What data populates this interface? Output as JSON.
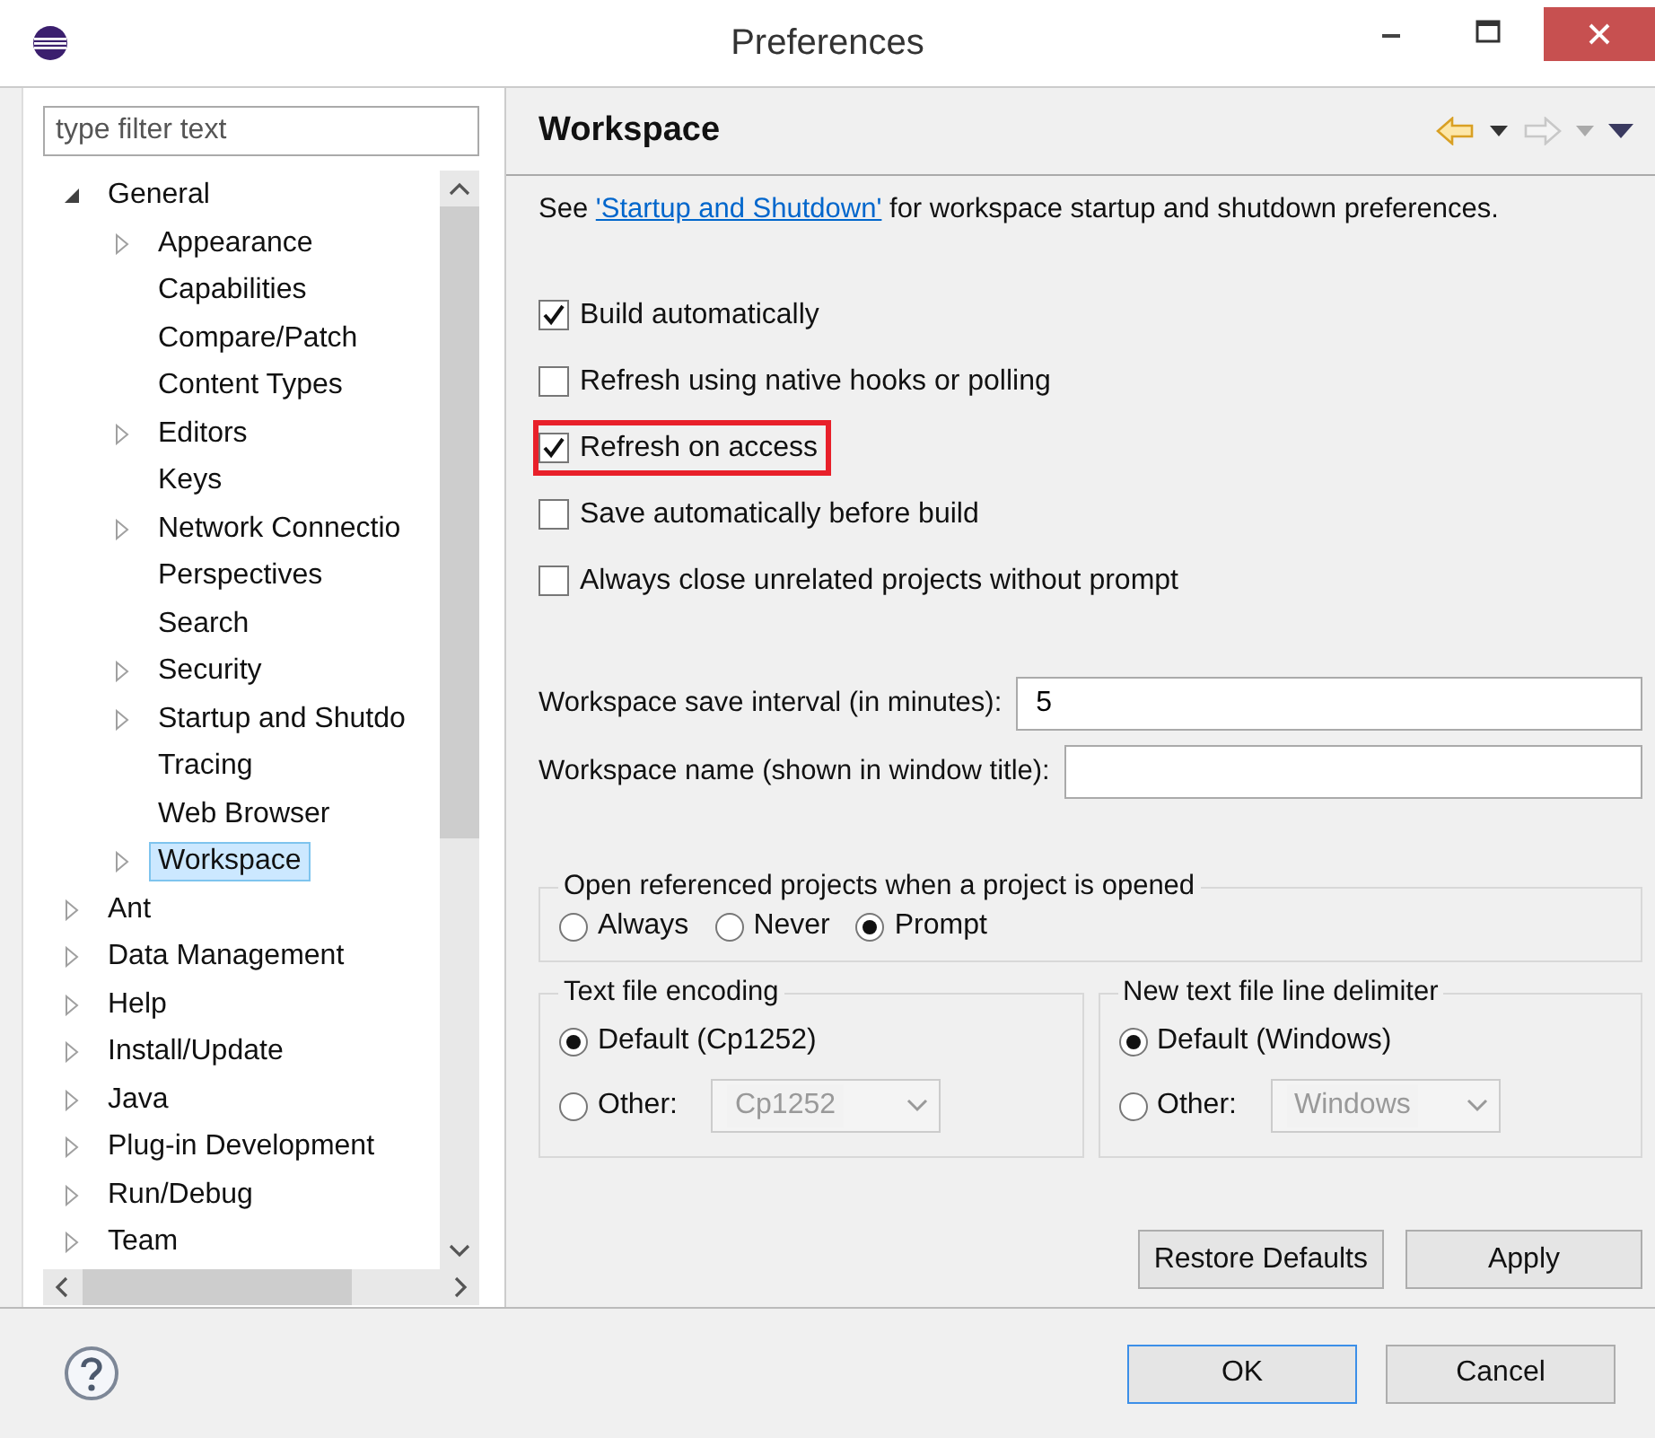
{
  "window": {
    "title": "Preferences"
  },
  "filter": {
    "placeholder": "type filter text"
  },
  "tree": [
    {
      "label": "General",
      "expanded": true,
      "selected": false,
      "children": [
        {
          "label": "Appearance",
          "expanded": false,
          "selected": false
        },
        {
          "label": "Capabilities",
          "selected": false
        },
        {
          "label": "Compare/Patch",
          "selected": false
        },
        {
          "label": "Content Types",
          "selected": false
        },
        {
          "label": "Editors",
          "expanded": false,
          "selected": false
        },
        {
          "label": "Keys",
          "selected": false
        },
        {
          "label": "Network Connectio",
          "expanded": false,
          "selected": false
        },
        {
          "label": "Perspectives",
          "selected": false
        },
        {
          "label": "Search",
          "selected": false
        },
        {
          "label": "Security",
          "expanded": false,
          "selected": false
        },
        {
          "label": "Startup and Shutdo",
          "expanded": false,
          "selected": false
        },
        {
          "label": "Tracing",
          "selected": false
        },
        {
          "label": "Web Browser",
          "selected": false
        },
        {
          "label": "Workspace",
          "expanded": false,
          "selected": true
        }
      ]
    },
    {
      "label": "Ant",
      "expanded": false,
      "selected": false
    },
    {
      "label": "Data Management",
      "expanded": false,
      "selected": false
    },
    {
      "label": "Help",
      "expanded": false,
      "selected": false
    },
    {
      "label": "Install/Update",
      "expanded": false,
      "selected": false
    },
    {
      "label": "Java",
      "expanded": false,
      "selected": false
    },
    {
      "label": "Plug-in Development",
      "expanded": false,
      "selected": false
    },
    {
      "label": "Run/Debug",
      "expanded": false,
      "selected": false
    },
    {
      "label": "Team",
      "expanded": false,
      "selected": false
    }
  ],
  "page": {
    "title": "Workspace",
    "intro": {
      "before": "See ",
      "link": "'Startup and Shutdown'",
      "after": " for workspace startup and shutdown preferences."
    },
    "checkboxes": [
      {
        "label": "Build automatically",
        "checked": true,
        "highlighted": false
      },
      {
        "label": "Refresh using native hooks or polling",
        "checked": false,
        "highlighted": false
      },
      {
        "label": "Refresh on access",
        "checked": true,
        "highlighted": true
      },
      {
        "label": "Save automatically before build",
        "checked": false,
        "highlighted": false
      },
      {
        "label": "Always close unrelated projects without prompt",
        "checked": false,
        "highlighted": false
      }
    ],
    "fields": [
      {
        "label": "Workspace save interval (in minutes):",
        "value": "5"
      },
      {
        "label": "Workspace name (shown in window title):"
      }
    ],
    "open_projects": {
      "legend": "Open referenced projects when a project is opened",
      "options": [
        {
          "label": "Always",
          "selected": false
        },
        {
          "label": "Never",
          "selected": false
        },
        {
          "label": "Prompt",
          "selected": true
        }
      ]
    },
    "groups": [
      {
        "legend": "Text file encoding",
        "options": [
          {
            "label": "Default (Cp1252)",
            "selected": true
          },
          {
            "label": "Other:",
            "selected": false
          }
        ],
        "combo": {
          "value": "Cp1252",
          "disabled": true
        }
      },
      {
        "legend": "New text file line delimiter",
        "options": [
          {
            "label": "Default (Windows)",
            "selected": true
          },
          {
            "label": "Other:",
            "selected": false
          }
        ],
        "combo": {
          "value": "Windows",
          "disabled": true
        }
      }
    ],
    "buttons": [
      "Restore Defaults",
      "Apply"
    ]
  },
  "buttons": [
    {
      "label": "OK",
      "default": true
    },
    {
      "label": "Cancel",
      "default": false
    }
  ]
}
